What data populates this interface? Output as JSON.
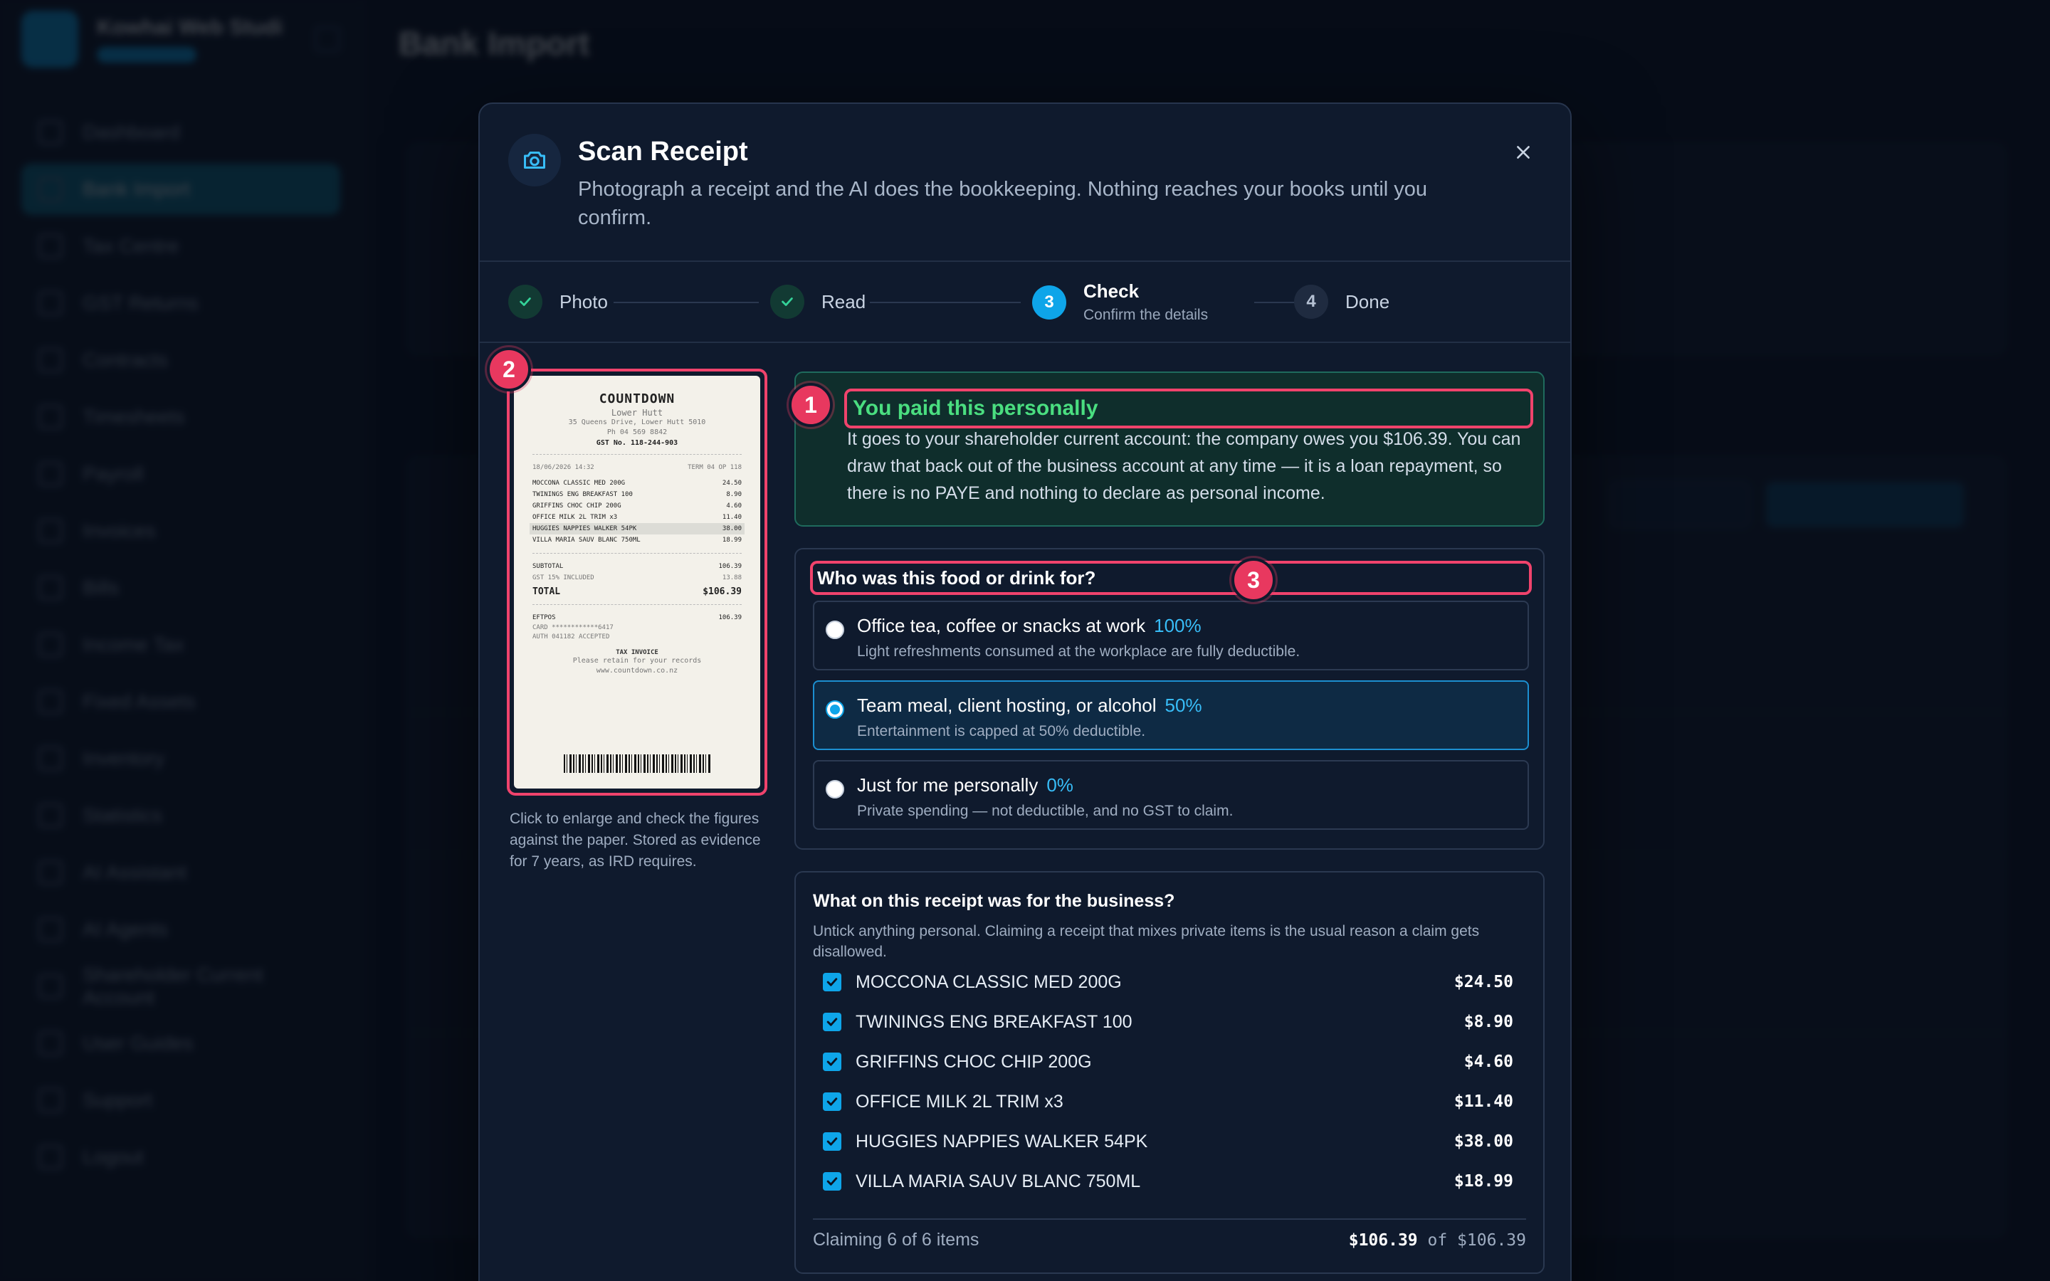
{
  "app": {
    "company": "Kowhai Web Studi",
    "page_title": "Bank Import",
    "nav": [
      "Dashboard",
      "Bank Import",
      "Tax Centre",
      "GST Returns",
      "Contracts",
      "Timesheets",
      "Payroll",
      "Invoices",
      "Bills",
      "Income Tax",
      "Fixed Assets",
      "Inventory",
      "Statistics",
      "AI Assistant",
      "AI Agents",
      "Shareholder Current Account",
      "User Guides",
      "Support",
      "Logout"
    ]
  },
  "modal": {
    "title": "Scan Receipt",
    "subtitle": "Photograph a receipt and the AI does the bookkeeping. Nothing reaches your books until you confirm.",
    "close_icon": "close-icon",
    "camera_icon": "camera-icon"
  },
  "steps": [
    {
      "label": "Photo",
      "state": "done"
    },
    {
      "label": "Read",
      "state": "done"
    },
    {
      "num": "3",
      "label": "Check",
      "sub": "Confirm the details",
      "state": "current"
    },
    {
      "num": "4",
      "label": "Done",
      "state": "todo"
    }
  ],
  "badges": [
    "1",
    "2",
    "3"
  ],
  "receipt": {
    "store": "COUNTDOWN",
    "branch": "Lower Hutt",
    "address": "35 Queens Drive, Lower Hutt 5010",
    "phone": "Ph 04 569 8842",
    "gst": "GST No. 118-244-903",
    "date": "18/06/2026  14:32",
    "term": "TERM 04  OP 118",
    "lines": [
      {
        "name": "MOCCONA CLASSIC MED 200G",
        "amt": "24.50"
      },
      {
        "name": "TWININGS ENG BREAKFAST 100",
        "amt": "8.90"
      },
      {
        "name": "GRIFFINS CHOC CHIP 200G",
        "amt": "4.60"
      },
      {
        "name": "OFFICE MILK 2L TRIM x3",
        "amt": "11.40"
      },
      {
        "name": "HUGGIES NAPPIES WALKER 54PK",
        "amt": "38.00"
      },
      {
        "name": "VILLA MARIA SAUV BLANC 750ML",
        "amt": "18.99"
      }
    ],
    "subtotal_label": "SUBTOTAL",
    "subtotal": "106.39",
    "gst_label": "GST 15% INCLUDED",
    "gst_amt": "13.88",
    "total_label": "TOTAL",
    "total": "$106.39",
    "eftpos_label": "EFTPOS",
    "eftpos": "106.39",
    "card": "CARD  ************6417",
    "auth": "AUTH 041182   ACCEPTED",
    "tax_invoice": "TAX INVOICE",
    "retain": "Please retain for your records",
    "web": "www.countdown.co.nz"
  },
  "receipt_caption": "Click to enlarge and check the figures against the paper. Stored as evidence for 7 years, as IRD requires.",
  "paid": {
    "title": "You paid this personally",
    "text": "It goes to your shareholder current account: the company owes you $106.39. You can draw that back out of the business account at any time — it is a loan repayment, so there is no PAYE and nothing to declare as personal income."
  },
  "food": {
    "question": "Who was this food or drink for?",
    "options": [
      {
        "label": "Office tea, coffee or snacks at work",
        "pct": "100%",
        "desc": "Light refreshments consumed at the workplace are fully deductible.",
        "selected": false
      },
      {
        "label": "Team meal, client hosting, or alcohol",
        "pct": "50%",
        "desc": "Entertainment is capped at 50% deductible.",
        "selected": true
      },
      {
        "label": "Just for me personally",
        "pct": "0%",
        "desc": "Private spending — not deductible, and no GST to claim.",
        "selected": false
      }
    ]
  },
  "business": {
    "title": "What on this receipt was for the business?",
    "desc": "Untick anything personal. Claiming a receipt that mixes private items is the usual reason a claim gets disallowed.",
    "items": [
      {
        "name": "MOCCONA CLASSIC MED 200G",
        "amount": "$24.50",
        "checked": true
      },
      {
        "name": "TWININGS ENG BREAKFAST 100",
        "amount": "$8.90",
        "checked": true
      },
      {
        "name": "GRIFFINS CHOC CHIP 200G",
        "amount": "$4.60",
        "checked": true
      },
      {
        "name": "OFFICE MILK 2L TRIM x3",
        "amount": "$11.40",
        "checked": true
      },
      {
        "name": "HUGGIES NAPPIES WALKER 54PK",
        "amount": "$38.00",
        "checked": true
      },
      {
        "name": "VILLA MARIA SAUV BLANC 750ML",
        "amount": "$18.99",
        "checked": true
      }
    ],
    "claiming": "Claiming 6 of 6 items",
    "claim_amount": "$106.39",
    "claim_of": "of $106.39"
  },
  "colors": {
    "accent": "#0ea5e9",
    "highlight": "#f0436c",
    "success": "#4ade80"
  }
}
